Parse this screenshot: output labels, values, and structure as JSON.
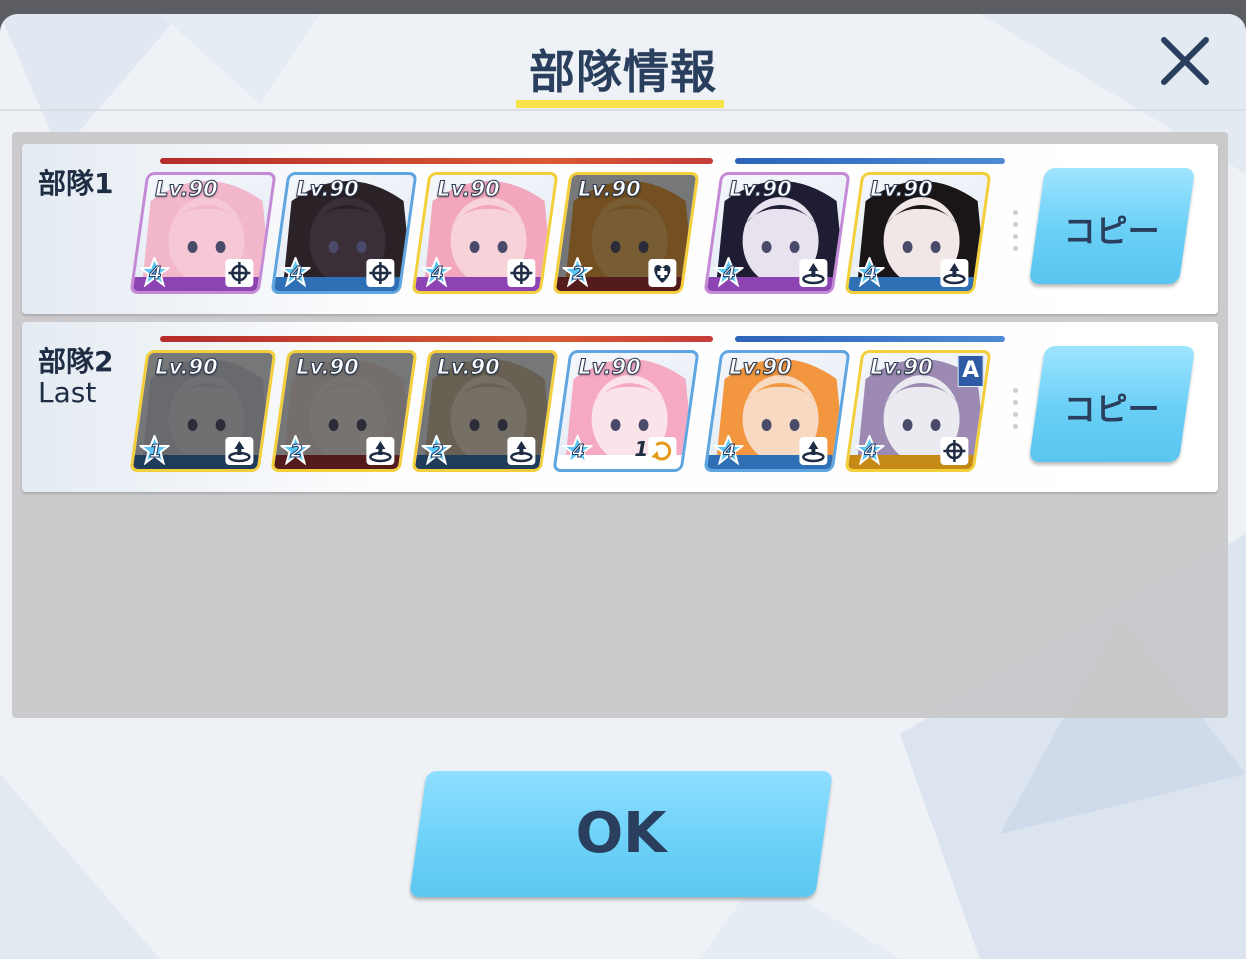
{
  "dialog": {
    "title": "部隊情報",
    "close_icon": "close-icon"
  },
  "squads": [
    {
      "name": "部隊1",
      "sub": "",
      "copy_label": "コピー",
      "members": [
        {
          "level": "Lv.90",
          "stars": "4",
          "role_icon": "target-icon",
          "border": "#c48ad6",
          "dimmed": false,
          "skin": "#f6c8d6",
          "hair": "#f3b7cb",
          "stripe": "#8d44b3"
        },
        {
          "level": "Lv.90",
          "stars": "4",
          "role_icon": "target-icon",
          "border": "#5fa6e0",
          "dimmed": false,
          "skin": "#3a2f38",
          "hair": "#2b2228",
          "stripe": "#2e6fb5"
        },
        {
          "level": "Lv.90",
          "stars": "4",
          "role_icon": "target-icon",
          "border": "#f2cf3b",
          "dimmed": false,
          "skin": "#f7d2d8",
          "hair": "#f2a7bd",
          "stripe": "#8d44b3"
        },
        {
          "level": "Lv.90",
          "stars": "2",
          "role_icon": "heal-icon",
          "border": "#f2cf3b",
          "dimmed": true,
          "skin": "#f1b562",
          "hair": "#e79a3a",
          "stripe": "#a3262d"
        },
        {
          "level": "Lv.90",
          "stars": "4",
          "role_icon": "support-icon",
          "border": "#c48ad6",
          "dimmed": false,
          "skin": "#e7e2ee",
          "hair": "#1f1d33",
          "stripe": "#8d44b3"
        },
        {
          "level": "Lv.90",
          "stars": "4",
          "role_icon": "support-icon",
          "border": "#f2cf3b",
          "dimmed": false,
          "skin": "#f1e7e6",
          "hair": "#1a1618",
          "stripe": "#2e6fb5"
        }
      ]
    },
    {
      "name": "部隊2",
      "sub": "Last",
      "copy_label": "コピー",
      "members": [
        {
          "level": "Lv.90",
          "stars": "1",
          "role_icon": "support-icon",
          "border": "#f2cf3b",
          "dimmed": true,
          "skin": "#dfe3ee",
          "hair": "#cfd4e2",
          "stripe": "#2e6fb5"
        },
        {
          "level": "Lv.90",
          "stars": "2",
          "role_icon": "support-icon",
          "border": "#f2cf3b",
          "dimmed": true,
          "skin": "#f0e8e6",
          "hair": "#e8e0de",
          "stripe": "#a3262d"
        },
        {
          "level": "Lv.90",
          "stars": "2",
          "role_icon": "support-icon",
          "border": "#f2cf3b",
          "dimmed": true,
          "skin": "#eadfce",
          "hair": "#cfc0a6",
          "stripe": "#2e6fb5"
        },
        {
          "level": "Lv.90",
          "stars": "4",
          "role_icon": "tactic-icon",
          "border": "#5fa6e0",
          "dimmed": false,
          "skin": "#fbe3ea",
          "hair": "#f5a9c3",
          "stripe": "#ffffff",
          "role_text": "1"
        },
        {
          "level": "Lv.90",
          "stars": "4",
          "role_icon": "support-icon",
          "border": "#5fa6e0",
          "dimmed": false,
          "skin": "#f8d9c2",
          "hair": "#f2973f",
          "stripe": "#2e6fb5"
        },
        {
          "level": "Lv.90",
          "stars": "4",
          "role_icon": "target-icon",
          "border": "#f2cf3b",
          "dimmed": false,
          "skin": "#eaeaf0",
          "hair": "#9c8ab2",
          "stripe": "#c58a15",
          "rank": "A"
        }
      ]
    }
  ],
  "ok_label": "OK"
}
